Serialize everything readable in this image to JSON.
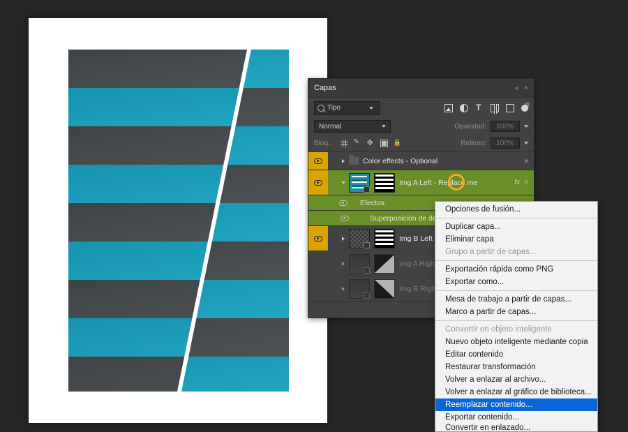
{
  "panel": {
    "title": "Capas",
    "search_label": "Tipo",
    "blend_mode": "Normal",
    "opacity_label": "Opacidad:",
    "opacity_value": "100%",
    "lock_label": "Bloq.:",
    "fill_label": "Relleno:",
    "fill_value": "100%",
    "fx_label": "fx"
  },
  "layers": {
    "group": "Color effects - Optional",
    "imgA": "Img A Left - Replace me",
    "efectos": "Efectos",
    "superpos": "Superposición de deg",
    "imgB": "Img B Left - Re",
    "imgAR": "Img A Right",
    "imgBR": "Img B Right"
  },
  "menu": {
    "blend": "Opciones de fusión...",
    "dup": "Duplicar capa...",
    "del": "Eliminar capa",
    "group": "Grupo a partir de capas...",
    "qpng": "Exportación rápida como PNG",
    "expas": "Exportar como...",
    "artb": "Mesa de trabajo a partir de capas...",
    "frame": "Marco a partir de capas...",
    "toSO": "Convertir en objeto inteligente",
    "newSO": "Nuevo objeto inteligente mediante copia",
    "editC": "Editar contenido",
    "restT": "Restaurar transformación",
    "relinkF": "Volver a enlazar al archivo...",
    "relinkL": "Volver a enlazar al gráfico de biblioteca...",
    "replace": "Reemplazar contenido...",
    "exportC": "Exportar contenido...",
    "toLinked": "Convertir en enlazado..."
  }
}
